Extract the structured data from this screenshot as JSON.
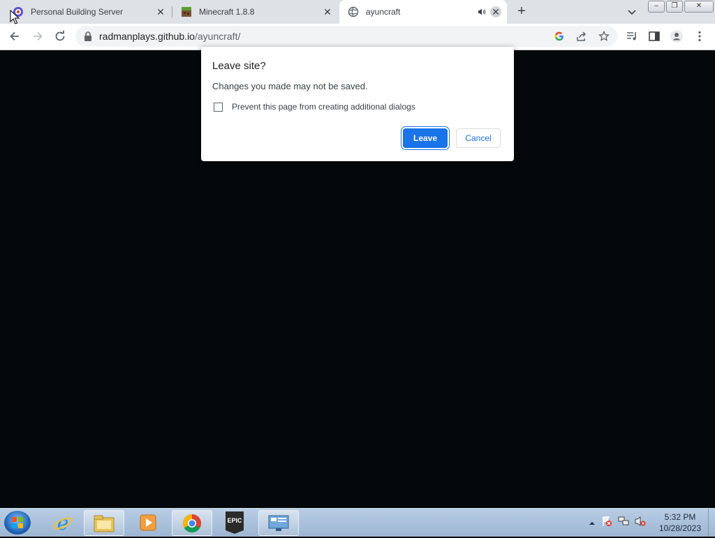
{
  "browser": {
    "tabs": [
      {
        "title": "Personal Building Server",
        "icon": "server-favicon"
      },
      {
        "title": "Minecraft 1.8.8",
        "icon": "minecraft-favicon"
      },
      {
        "title": "ayuncraft",
        "icon": "globe-icon",
        "active": true,
        "audio": true
      }
    ],
    "url_host": "radmanplays.github.io",
    "url_path": "/ayuncraft/",
    "window_controls": [
      "minimize",
      "restore",
      "close"
    ]
  },
  "dialog": {
    "title": "Leave site?",
    "message": "Changes you made may not be saved.",
    "checkbox_label": "Prevent this page from creating additional dialogs",
    "checkbox_checked": false,
    "leave_label": "Leave",
    "cancel_label": "Cancel",
    "accent": "#1a73e8"
  },
  "taskbar": {
    "apps": [
      "internet-explorer",
      "file-explorer",
      "media-player",
      "chrome",
      "epic-games",
      "remote-desktop"
    ],
    "epic_label": "EPIC",
    "clock_time": "5:32 PM",
    "clock_date": "10/28/2023"
  },
  "page": {
    "background": "#05080a"
  }
}
